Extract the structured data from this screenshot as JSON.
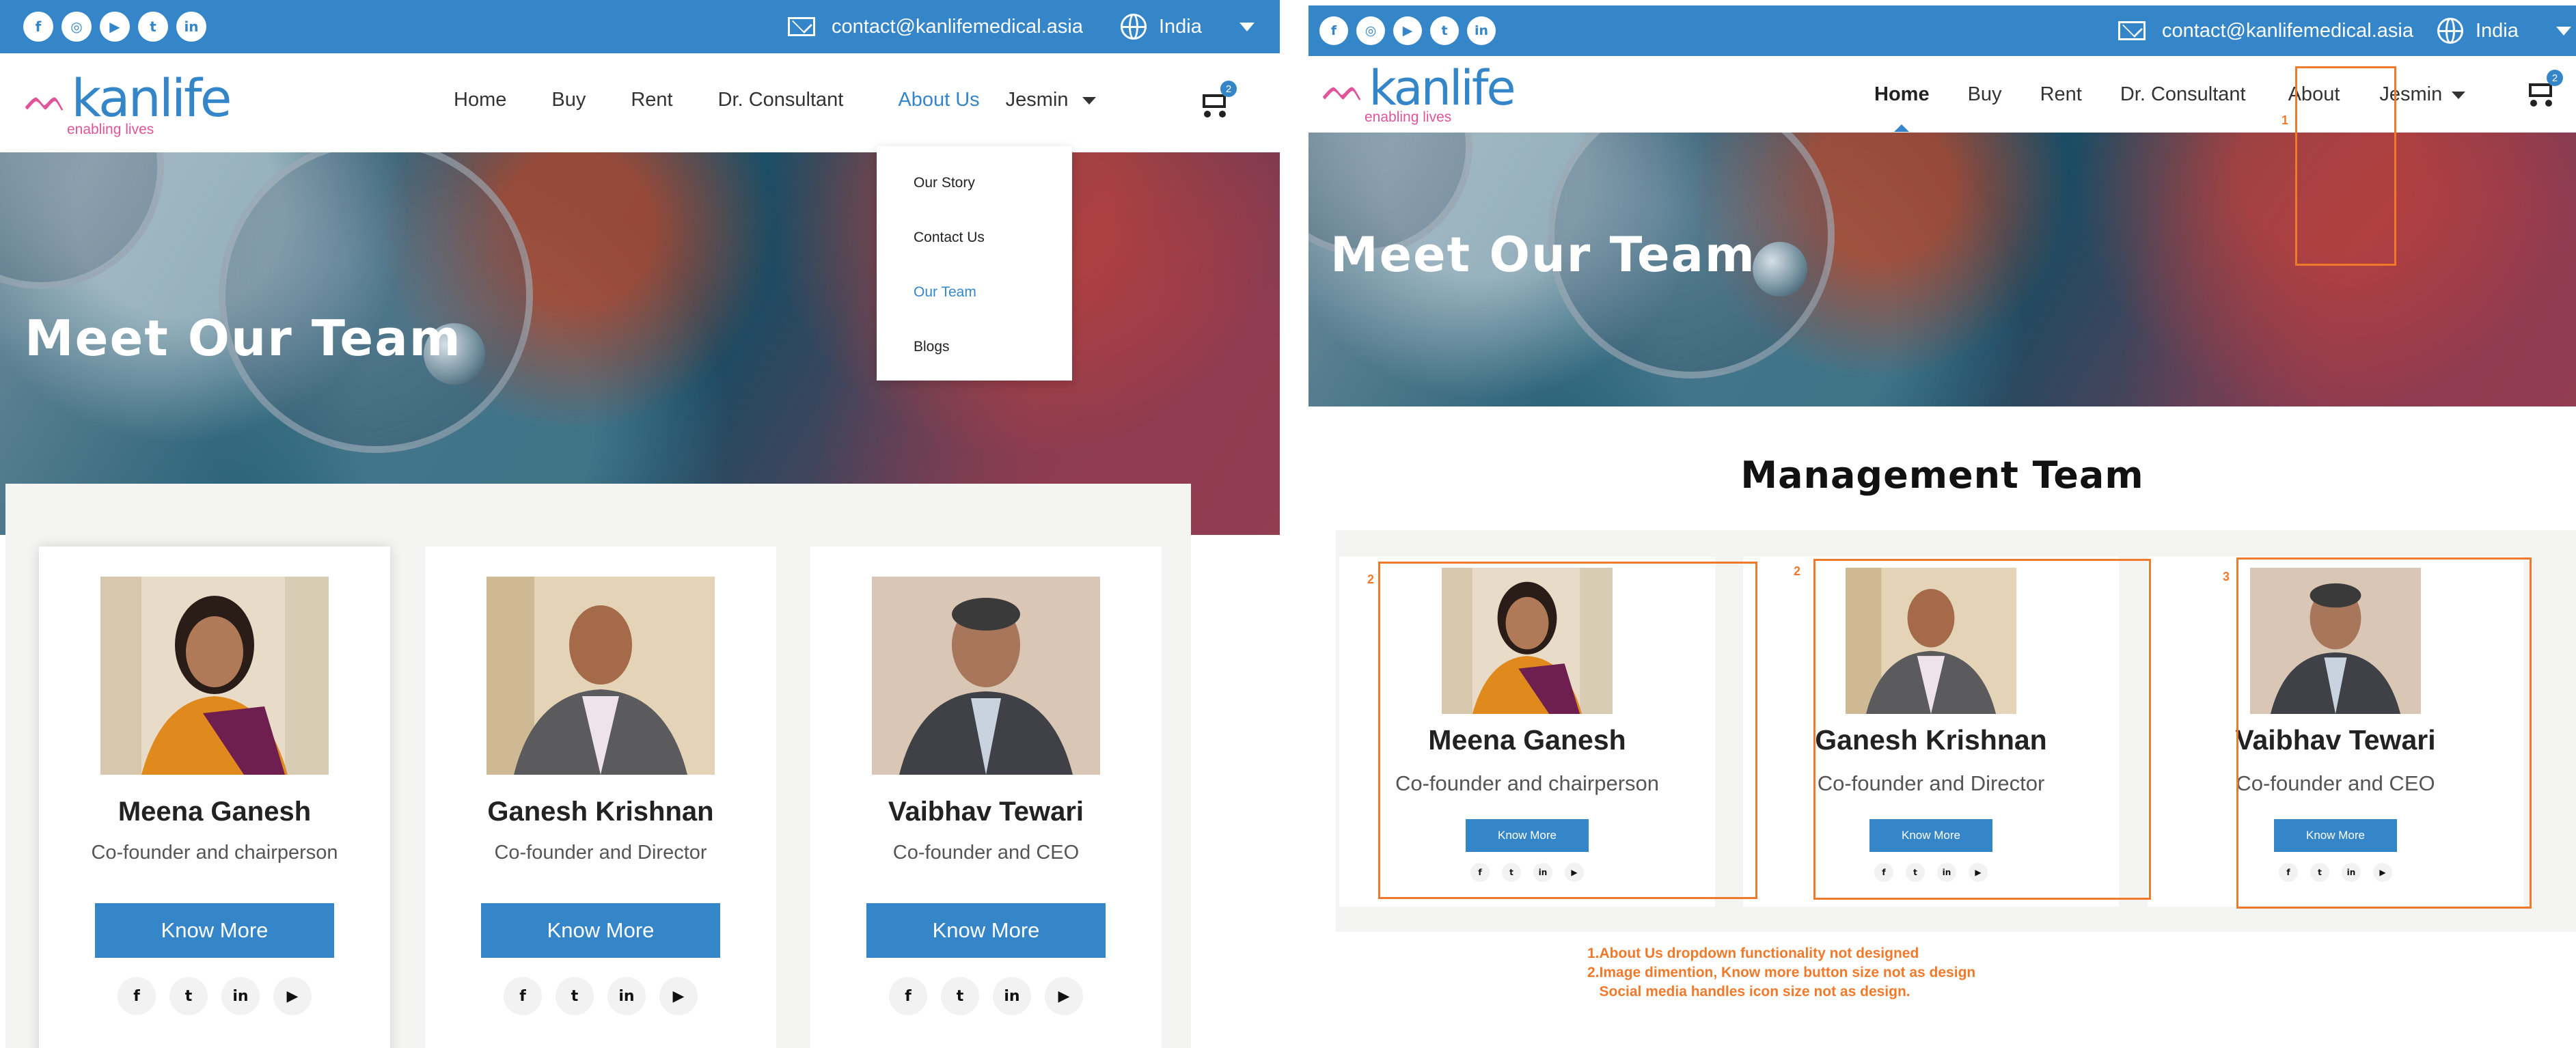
{
  "left": {
    "contact_email": "contact@kanlifemedical.asia",
    "country": "India",
    "logo": {
      "brand": "kanlife",
      "tagline": "enabling lives"
    },
    "nav": [
      "Home",
      "Buy",
      "Rent",
      "Dr. Consultant",
      "About Us",
      "Jesmin"
    ],
    "cart_count": "2",
    "dropdown": [
      "Our Story",
      "Contact Us",
      "Our Team",
      "Blogs"
    ],
    "hero_title": "Meet Our Team",
    "team": [
      {
        "name": "Meena Ganesh",
        "role": "Co-founder and chairperson",
        "button": "Know More"
      },
      {
        "name": "Ganesh Krishnan",
        "role": "Co-founder and Director",
        "button": "Know More"
      },
      {
        "name": "Vaibhav Tewari",
        "role": "Co-founder and CEO",
        "button": "Know More"
      }
    ]
  },
  "right": {
    "contact_email": "contact@kanlifemedical.asia",
    "country": "India",
    "logo": {
      "brand": "kanlife",
      "tagline": "enabling lives"
    },
    "nav": [
      "Home",
      "Buy",
      "Rent",
      "Dr. Consultant",
      "About",
      "Jesmin"
    ],
    "cart_count": "2",
    "hero_title": "Meet Our Team",
    "section_title": "Management Team",
    "team": [
      {
        "name": "Meena Ganesh",
        "role": "Co-founder and chairperson",
        "button": "Know More"
      },
      {
        "name": "Ganesh Krishnan",
        "role": "Co-founder and Director",
        "button": "Know More"
      },
      {
        "name": "Vaibhav Tewari",
        "role": "Co-founder and CEO",
        "button": "Know More"
      }
    ],
    "annotation_numbers": [
      "1",
      "2",
      "2",
      "3"
    ],
    "notes": [
      "1.About Us dropdown functionality not designed",
      "2.Image dimention, Know more button size not as design",
      "   Social media handles icon size not as design."
    ]
  },
  "social_icons": [
    "facebook-icon",
    "instagram-icon",
    "youtube-icon",
    "twitter-icon",
    "linkedin-icon"
  ],
  "card_social_icons": [
    "facebook-icon",
    "twitter-icon",
    "linkedin-icon",
    "youtube-icon"
  ],
  "colors": {
    "brand_blue": "#3585c9",
    "brand_pink": "#e0549a",
    "annotation_orange": "#f07a2c"
  }
}
